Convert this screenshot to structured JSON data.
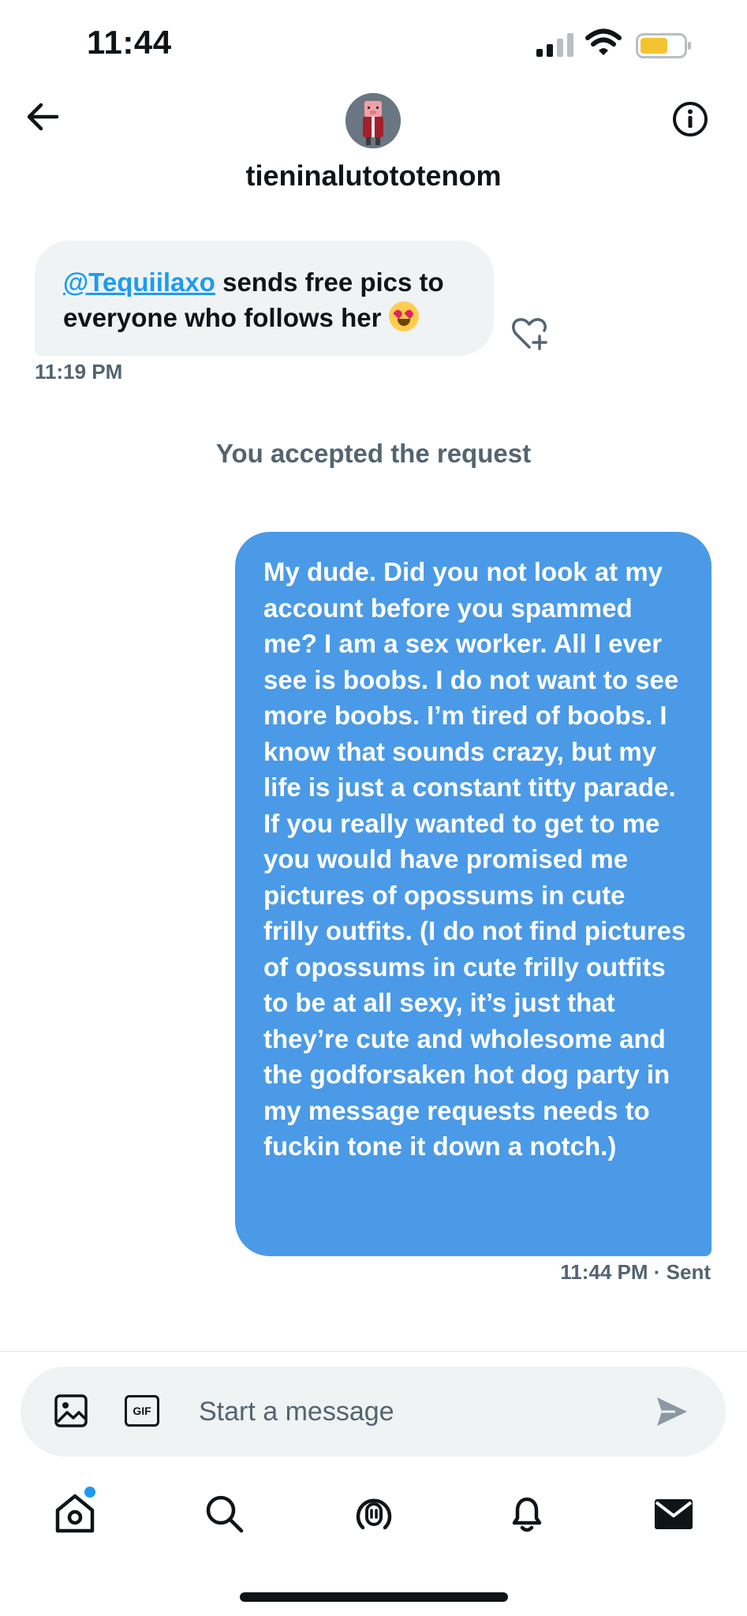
{
  "status_bar": {
    "time": "11:44",
    "battery_color": "#f4c430"
  },
  "header": {
    "username": "tieninalutototenom",
    "back_icon": "arrow-left-icon",
    "info_icon": "info-icon"
  },
  "conversation": {
    "incoming": {
      "mention": "@Tequiilaxo",
      "text": " sends free pics to everyone who follows her ",
      "emoji": "heart-eyes-emoji",
      "time": "11:19 PM"
    },
    "system_message": "You accepted the request",
    "outgoing": {
      "text": "My dude. Did you not look at my account before you spammed me? I am a sex worker. All I ever see is boobs. I do not want to see more boobs. I’m tired of boobs. I know that sounds crazy, but my life is just a constant titty parade. If you really wanted to get to me you would have promised me pictures of opossums in cute frilly outfits. (I do not find pictures of opossums in cute frilly outfits to be at all sexy, it’s just that they’re cute and wholesome and the godforsaken hot dog party in my message requests needs to fuckin tone it down a notch.)",
      "time": "11:44 PM",
      "status": "· Sent",
      "bubble_color": "#4a9ae8"
    }
  },
  "composer": {
    "placeholder": "Start a message",
    "gif_label": "GIF"
  },
  "tab_bar": {
    "items": [
      "home-icon",
      "search-icon",
      "spaces-icon",
      "notifications-icon",
      "messages-icon"
    ],
    "accent": "#1d9bf0"
  }
}
